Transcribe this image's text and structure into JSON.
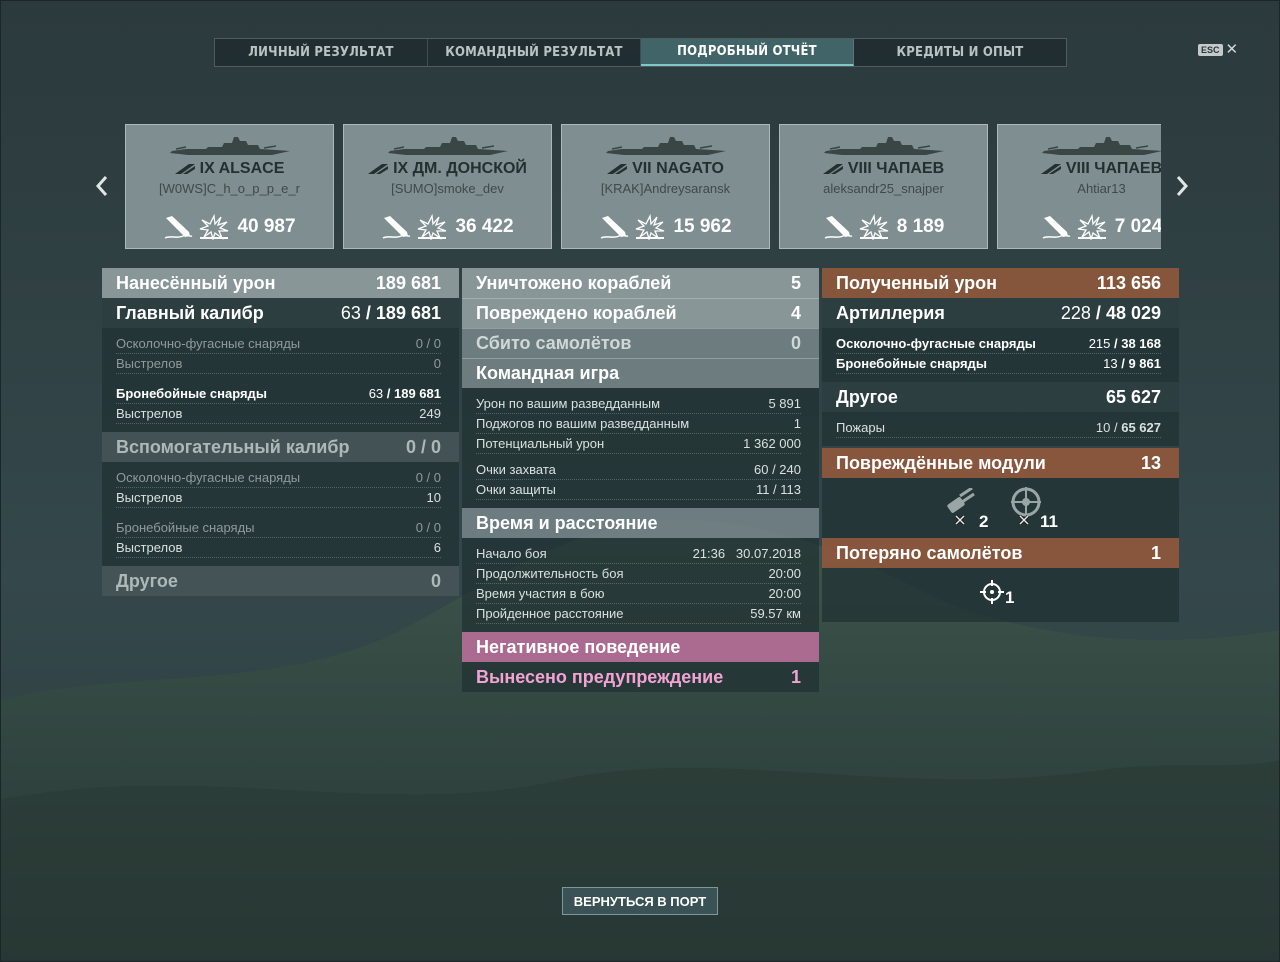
{
  "tabs": [
    {
      "label": "ЛИЧНЫЙ РЕЗУЛЬТАТ"
    },
    {
      "label": "КОМАНДНЫЙ РЕЗУЛЬТАТ"
    },
    {
      "label": "ПОДРОБНЫЙ ОТЧЁТ"
    },
    {
      "label": "КРЕДИТЫ И ОПЫТ"
    }
  ],
  "active_tab": "ПОДРОБНЫЙ ОТЧЁТ",
  "esc_label": "ESC",
  "ships": [
    {
      "name": "IX ALSACE",
      "player": "[W0WS]C_h_o_p_p_e_r",
      "damage": "40 987"
    },
    {
      "name": "IX ДМ. ДОНСКОЙ",
      "player": "[SUMO]smoke_dev",
      "damage": "36 422"
    },
    {
      "name": "VII NAGATO",
      "player": "[KRAK]Andreysaransk",
      "damage": "15 962"
    },
    {
      "name": "VIII ЧАПАЕВ",
      "player": "aleksandr25_snajper",
      "damage": "8 189"
    },
    {
      "name": "VIII ЧАПАЕВ",
      "player": "Ahtiar13",
      "damage": "7 024"
    }
  ],
  "left": {
    "dealt_damage": {
      "label": "Нанесённый урон",
      "value": "189 681"
    },
    "main_caliber": {
      "label": "Главный калибр",
      "hits": "63",
      "damage": "189 681"
    },
    "he_shells": {
      "label": "Осколочно-фугасные снаряды",
      "value": "0 / 0"
    },
    "he_shots": {
      "label": "Выстрелов",
      "value": "0"
    },
    "ap_shells": {
      "label": "Бронебойные снаряды",
      "hits": "63",
      "damage": "189 681"
    },
    "ap_shots": {
      "label": "Выстрелов",
      "value": "249"
    },
    "secondary": {
      "label": "Вспомогательный калибр",
      "value": "0 / 0"
    },
    "sec_he": {
      "label": "Осколочно-фугасные снаряды",
      "value": "0 / 0"
    },
    "sec_he_shots": {
      "label": "Выстрелов",
      "value": "10"
    },
    "sec_ap": {
      "label": "Бронебойные снаряды",
      "value": "0 / 0"
    },
    "sec_ap_shots": {
      "label": "Выстрелов",
      "value": "6"
    },
    "other": {
      "label": "Другое",
      "value": "0"
    }
  },
  "middle": {
    "destroyed": {
      "label": "Уничтожено кораблей",
      "value": "5"
    },
    "damaged": {
      "label": "Повреждено кораблей",
      "value": "4"
    },
    "planes": {
      "label": "Сбито самолётов",
      "value": "0"
    },
    "team_play": {
      "title": "Командная игра",
      "rows": [
        {
          "label": "Урон по вашим разведданным",
          "value": "5 891"
        },
        {
          "label": "Поджогов по вашим разведданным",
          "value": "1"
        },
        {
          "label": "Потенциальный урон",
          "value": "1 362 000"
        }
      ],
      "rows2": [
        {
          "label": "Очки захвата",
          "value": "60 / 240"
        },
        {
          "label": "Очки защиты",
          "value": "11 / 113"
        }
      ]
    },
    "time_distance": {
      "title": "Время и расстояние",
      "rows": [
        {
          "label": "Начало боя",
          "value": "21:36   30.07.2018"
        },
        {
          "label": "Продолжительность боя",
          "value": "20:00"
        },
        {
          "label": "Время участия в бою",
          "value": "20:00"
        },
        {
          "label": "Пройденное расстояние",
          "value": "59.57 км"
        }
      ]
    },
    "negative": {
      "title": "Негативное поведение",
      "label": "Вынесено предупреждение",
      "value": "1"
    }
  },
  "right": {
    "received": {
      "label": "Полученный урон",
      "value": "113 656"
    },
    "artillery": {
      "label": "Артиллерия",
      "hits": "228",
      "damage": "48 029"
    },
    "he": {
      "label": "Осколочно-фугасные снаряды",
      "hits": "215",
      "damage": "38 168"
    },
    "ap": {
      "label": "Бронебойные снаряды",
      "hits": "13",
      "damage": "9 861"
    },
    "other": {
      "label": "Другое",
      "value": "65 627"
    },
    "fires": {
      "label": "Пожары",
      "hits": "10",
      "damage": "65 627"
    },
    "modules": {
      "label": "Повреждённые модули",
      "value": "13",
      "guns": "2",
      "steering": "11"
    },
    "lost_planes": {
      "label": "Потеряно самолётов",
      "value": "1",
      "aa_count": "1"
    }
  },
  "button_label": "ВЕРНУТЬСЯ В ПОРТ"
}
